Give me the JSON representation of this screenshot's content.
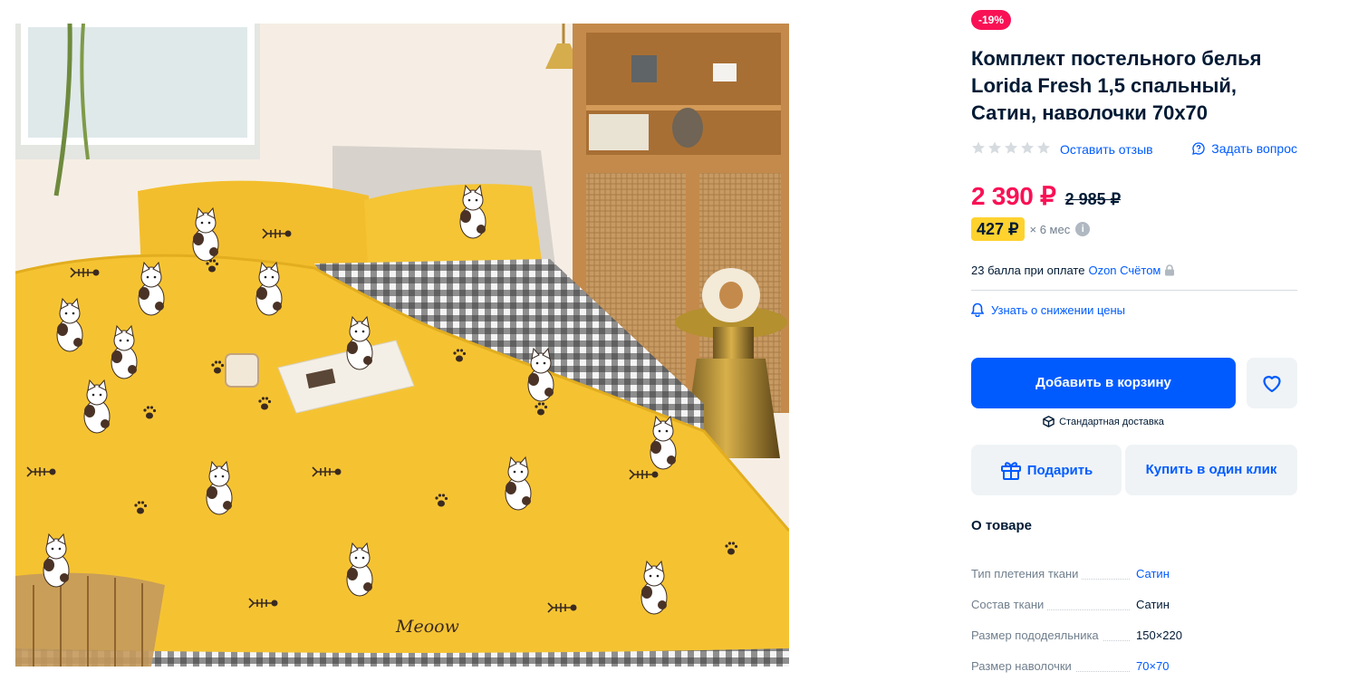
{
  "product": {
    "discount_badge": "-19%",
    "title": "Комплект постельного белья Lorida Fresh 1,5 спальный, Сатин, наволочки 70х70",
    "rating": 0,
    "review_link": "Оставить отзыв",
    "ask_link": "Задать вопрос",
    "price": "2 390 ₽",
    "old_price": "2 985 ₽",
    "installment_price": "427 ₽",
    "installment_term": "× 6 мес",
    "points_text": "23 балла при оплате",
    "points_link": "Ozon Счётом",
    "price_alert": "Узнать о снижении цены",
    "add_to_cart": "Добавить в корзину",
    "delivery": "Стандартная доставка",
    "gift": "Подарить",
    "buy_one_click": "Купить в один клик",
    "about_title": "О товаре",
    "specs": [
      {
        "key": "Тип плетения ткани",
        "value": "Сатин"
      },
      {
        "key": "Состав ткани",
        "value": "Сатин"
      },
      {
        "key": "Размер пододеяльника",
        "value": "150×220"
      },
      {
        "key": "Размер наволочки",
        "value": "70×70"
      }
    ]
  },
  "photo_text": "Meoow",
  "colors": {
    "accent_blue": "#005bff",
    "price_pink": "#f91155",
    "installment_yellow": "#ffd22e",
    "bedding_yellow": "#f5c332"
  }
}
